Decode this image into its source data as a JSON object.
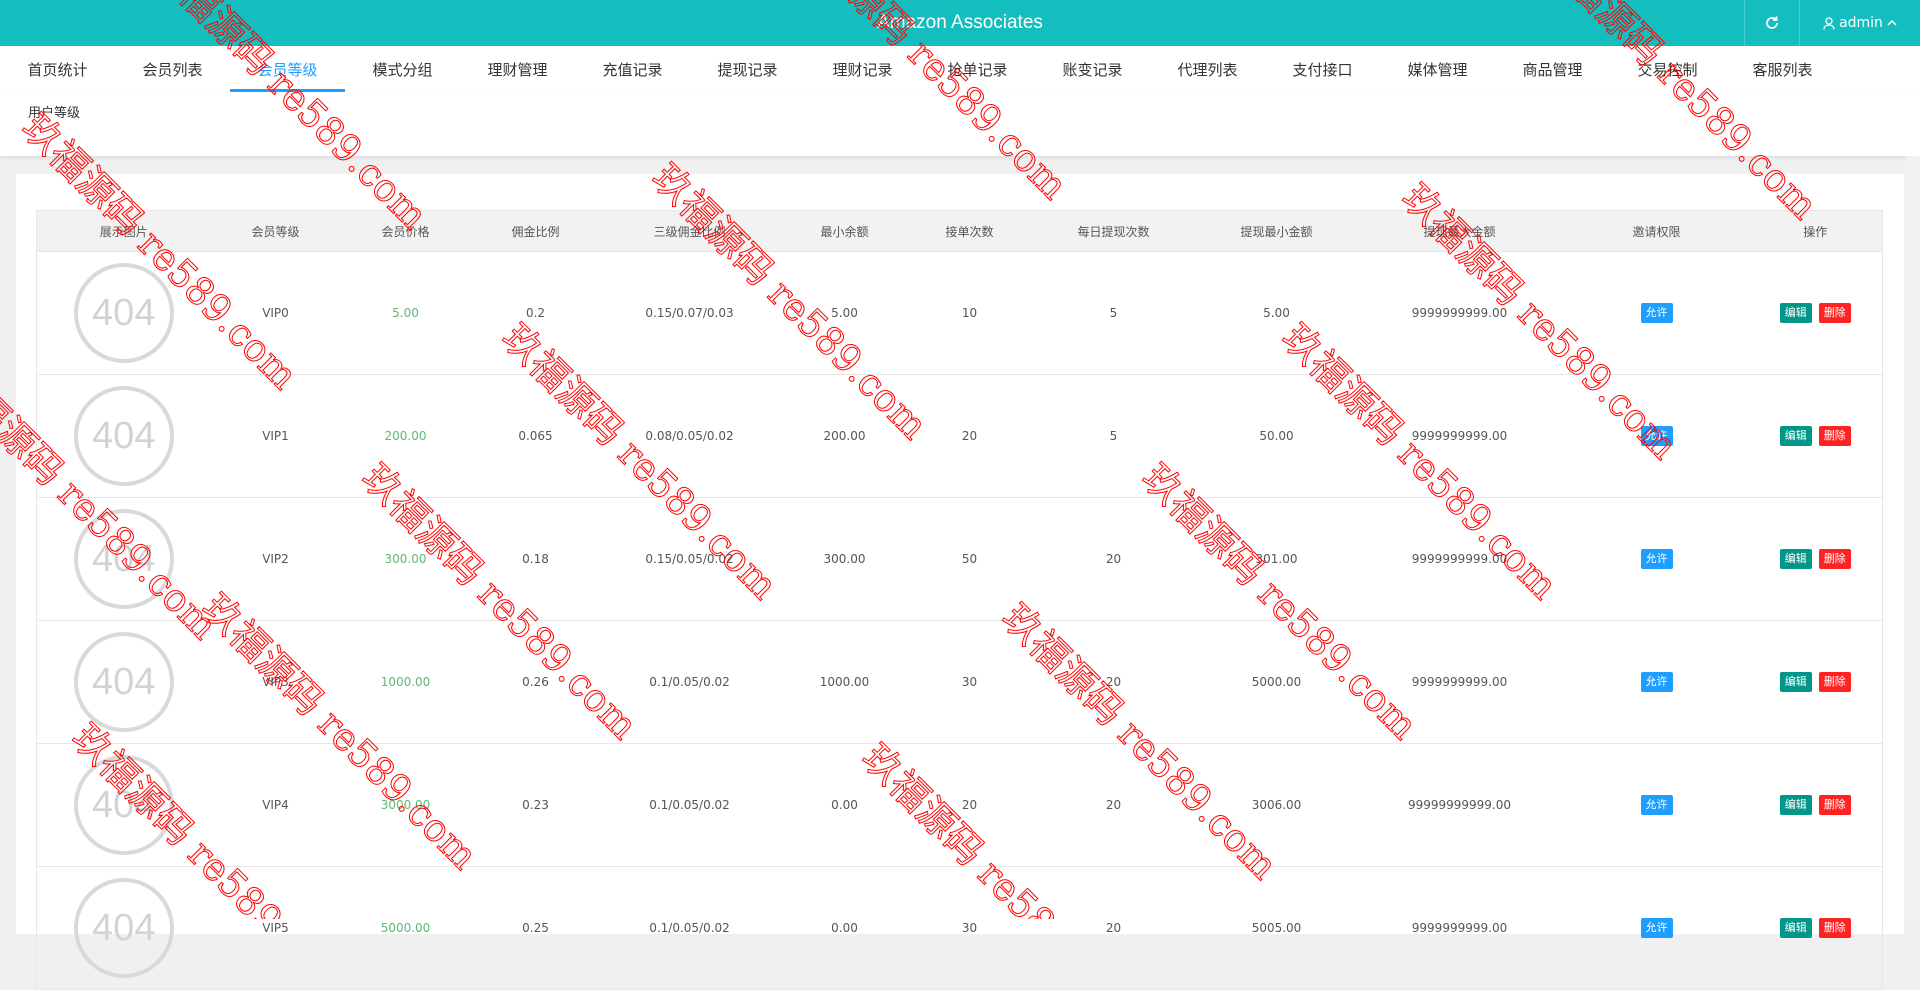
{
  "header": {
    "title": "Amazon Associates",
    "user": "admin"
  },
  "nav": [
    "首页统计",
    "会员列表",
    "会员等级",
    "模式分组",
    "理财管理",
    "充值记录",
    "提现记录",
    "理财记录",
    "抢单记录",
    "账变记录",
    "代理列表",
    "支付接口",
    "媒体管理",
    "商品管理",
    "交易控制",
    "客服列表"
  ],
  "nav_active_index": 2,
  "breadcrumb": "用户等级",
  "table": {
    "columns": [
      "展示图片",
      "会员等级",
      "会员价格",
      "佣金比例",
      "三级佣金比例",
      "最小余额",
      "接单次数",
      "每日提现次数",
      "提现最小金额",
      "提现最大金额",
      "邀请权限",
      "操作"
    ],
    "image_placeholder": "404",
    "rows": [
      {
        "level": "VIP0",
        "price": "5.00",
        "commission": "0.2",
        "tier": "0.15/0.07/0.03",
        "min_balance": "5.00",
        "orders": "10",
        "daily_withdraw": "5",
        "withdraw_min": "5.00",
        "withdraw_max": "9999999999.00",
        "invite": "允许"
      },
      {
        "level": "VIP1",
        "price": "200.00",
        "commission": "0.065",
        "tier": "0.08/0.05/0.02",
        "min_balance": "200.00",
        "orders": "20",
        "daily_withdraw": "5",
        "withdraw_min": "50.00",
        "withdraw_max": "9999999999.00",
        "invite": "允许"
      },
      {
        "level": "VIP2",
        "price": "300.00",
        "commission": "0.18",
        "tier": "0.15/0.05/0.02",
        "min_balance": "300.00",
        "orders": "50",
        "daily_withdraw": "20",
        "withdraw_min": "301.00",
        "withdraw_max": "9999999999.00",
        "invite": "允许"
      },
      {
        "level": "VIP3",
        "price": "1000.00",
        "commission": "0.26",
        "tier": "0.1/0.05/0.02",
        "min_balance": "1000.00",
        "orders": "30",
        "daily_withdraw": "20",
        "withdraw_min": "5000.00",
        "withdraw_max": "9999999999.00",
        "invite": "允许"
      },
      {
        "level": "VIP4",
        "price": "3000.00",
        "commission": "0.23",
        "tier": "0.1/0.05/0.02",
        "min_balance": "0.00",
        "orders": "20",
        "daily_withdraw": "20",
        "withdraw_min": "3006.00",
        "withdraw_max": "99999999999.00",
        "invite": "允许"
      },
      {
        "level": "VIP5",
        "price": "5000.00",
        "commission": "0.25",
        "tier": "0.1/0.05/0.02",
        "min_balance": "0.00",
        "orders": "30",
        "daily_withdraw": "20",
        "withdraw_min": "5005.00",
        "withdraw_max": "9999999999.00",
        "invite": "允许"
      }
    ],
    "edit_label": "编辑",
    "delete_label": "删除"
  },
  "watermark": "玖福源码 re589.com",
  "colors": {
    "topbar": "#14bdbe",
    "active": "#1e9fff",
    "price": "#5fb878",
    "edit": "#009688",
    "delete": "#ff2222",
    "watermark": "#ff0000"
  }
}
